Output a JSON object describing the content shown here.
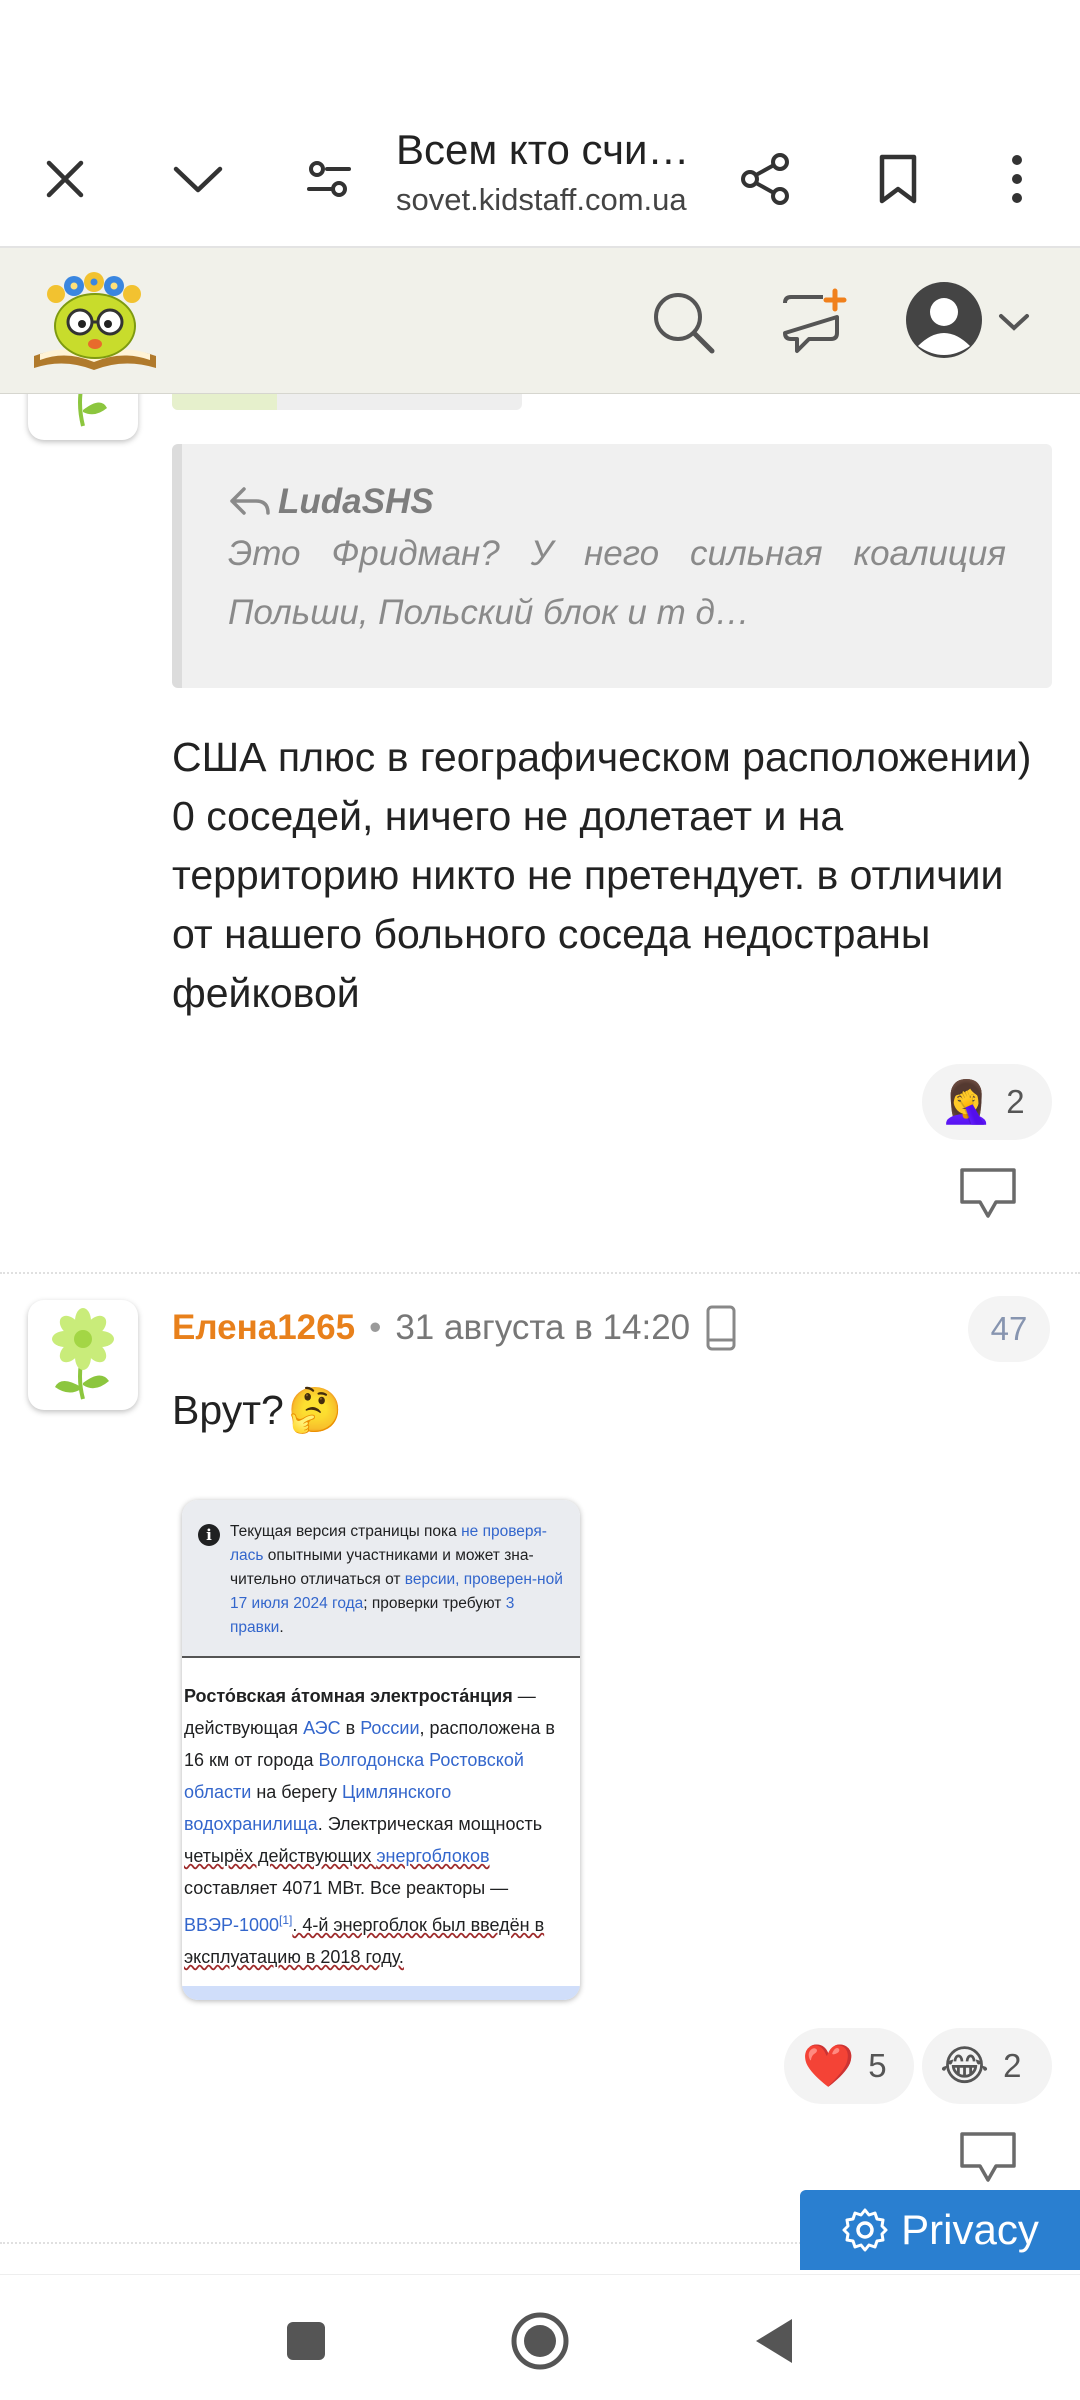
{
  "browser": {
    "page_title": "Всем кто счи…",
    "domain": "sovet.kidstaff.com.ua",
    "icons": [
      "close-icon",
      "chevron-down-icon",
      "tune-icon",
      "share-icon",
      "bookmark-icon",
      "more-vert-icon"
    ]
  },
  "site_header": {
    "icons": [
      "site-logo",
      "search-icon",
      "new-message-icon",
      "user-avatar-icon",
      "chevron-down-icon"
    ]
  },
  "post1": {
    "rating_progress": 0.3,
    "quote": {
      "author": "LudaSHS",
      "text": "Это Фридман? У него сильная коалиция Польши, Польский блок и т д…"
    },
    "text": "США плюс в географическом расположении) 0 соседей, ничего не долетает и на территорию никто не претендует. в отличии от нашего больного соседа недостраны фейковой",
    "reactions": [
      {
        "emoji": "🤦‍♀️",
        "count": "2"
      }
    ]
  },
  "post2": {
    "username": "Елена1265",
    "separator": "•",
    "timestamp": "31 августа в 14:20",
    "device_icon": "mobile-device-icon",
    "post_number": "47",
    "text": "Врут?",
    "emoji": "🤔",
    "attachment": {
      "notice": {
        "part1": "Текущая версия страницы пока ",
        "link1": "не проверя-лась",
        "part2": " опытными участниками и может зна-чительно отличаться от ",
        "link2": "версии, проверен-ной 17 июля 2024 года",
        "part3": "; проверки требуют ",
        "link3": "3 правки",
        "part4": "."
      },
      "body": {
        "title": "Росто́вская а́томная электроста́нция",
        "dash": " —",
        "l2a": "действующая ",
        "l2link1": "АЭС",
        "l2b": " в ",
        "l2link2": "России",
        "l2c": ", расположена в",
        "l3a": "16 км от города ",
        "l3link": "Волгодонска Ростовской",
        "l4link": "области",
        "l4a": " на берегу ",
        "l4link2": "Цимлянского",
        "l5link": "водохранилища",
        "l5a": ". Электрическая мощность",
        "l6a": "четырёх действующих ",
        "l6link": "энергоблоков",
        "l7a": "составляет 4071 МВт. Все реакторы —",
        "l8link": "ВВЭР-1000",
        "l8sup": "[1]",
        "l8a": ". 4-й энергоблок был введён в",
        "l9a": "эксплуатацию в 2018 году."
      }
    },
    "reactions": [
      {
        "emoji": "❤️",
        "count": "5"
      },
      {
        "emoji": "😂",
        "count": "2"
      }
    ]
  },
  "privacy_button": {
    "label": "Privacy"
  },
  "nav": {
    "icons": [
      "recents-icon",
      "home-icon",
      "back-icon"
    ]
  }
}
